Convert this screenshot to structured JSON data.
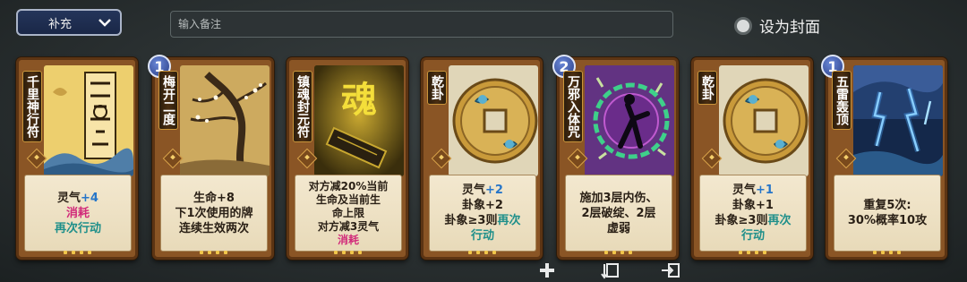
{
  "topbar": {
    "dropdown_label": "补充",
    "note_placeholder": "输入备注",
    "cover_label": "设为封面"
  },
  "cards": [
    {
      "name": "千里神行符",
      "level": "",
      "lines": [
        [
          {
            "t": "灵气"
          },
          {
            "t": "+4",
            "c": "blue"
          }
        ],
        [
          {
            "t": "消耗",
            "c": "red"
          }
        ],
        [
          {
            "t": "再次行动",
            "c": "teal"
          }
        ]
      ]
    },
    {
      "name": "梅开二度",
      "level": "1",
      "lines": [
        [
          {
            "t": "生命+8"
          }
        ],
        [
          {
            "t": "下1次使用的牌"
          }
        ],
        [
          {
            "t": "连续生效两次"
          }
        ]
      ]
    },
    {
      "name": "镇魂封元符",
      "level": "",
      "lines": [
        [
          {
            "t": "对方减20%当前"
          }
        ],
        [
          {
            "t": "生命及当前生"
          }
        ],
        [
          {
            "t": "命上限"
          }
        ],
        [
          {
            "t": "对方减3灵气"
          }
        ],
        [
          {
            "t": "消耗",
            "c": "red"
          }
        ]
      ]
    },
    {
      "name": "乾卦",
      "level": "",
      "lines": [
        [
          {
            "t": "灵气"
          },
          {
            "t": "+2",
            "c": "blue"
          }
        ],
        [
          {
            "t": "卦象+2"
          }
        ],
        [
          {
            "t": "卦象≥3则"
          },
          {
            "t": "再次",
            "c": "teal"
          }
        ],
        [
          {
            "t": "行动",
            "c": "teal"
          }
        ]
      ]
    },
    {
      "name": "万邪入体咒",
      "level": "2",
      "lines": [
        [
          {
            "t": "施加3层内伤、"
          }
        ],
        [
          {
            "t": "2层破绽、2层"
          }
        ],
        [
          {
            "t": "虚弱"
          }
        ]
      ]
    },
    {
      "name": "乾卦",
      "level": "",
      "lines": [
        [
          {
            "t": "灵气"
          },
          {
            "t": "+1",
            "c": "blue"
          }
        ],
        [
          {
            "t": "卦象+1"
          }
        ],
        [
          {
            "t": "卦象≥3则"
          },
          {
            "t": "再次",
            "c": "teal"
          }
        ],
        [
          {
            "t": "行动",
            "c": "teal"
          }
        ]
      ]
    },
    {
      "name": "五雷轰顶",
      "level": "1",
      "lines": [
        [
          {
            "t": "重复5次:"
          }
        ],
        [
          {
            "t": "30%概率10攻"
          }
        ]
      ]
    }
  ],
  "art_text": {
    "hun": "魂"
  },
  "icons": [
    "chevron-down-icon",
    "plus-icon",
    "card-swap-icon",
    "card-export-icon"
  ],
  "colors": {
    "accent_blue": "#2776c9",
    "consume_red": "#d12a7a",
    "action_teal": "#1e8f8a"
  }
}
